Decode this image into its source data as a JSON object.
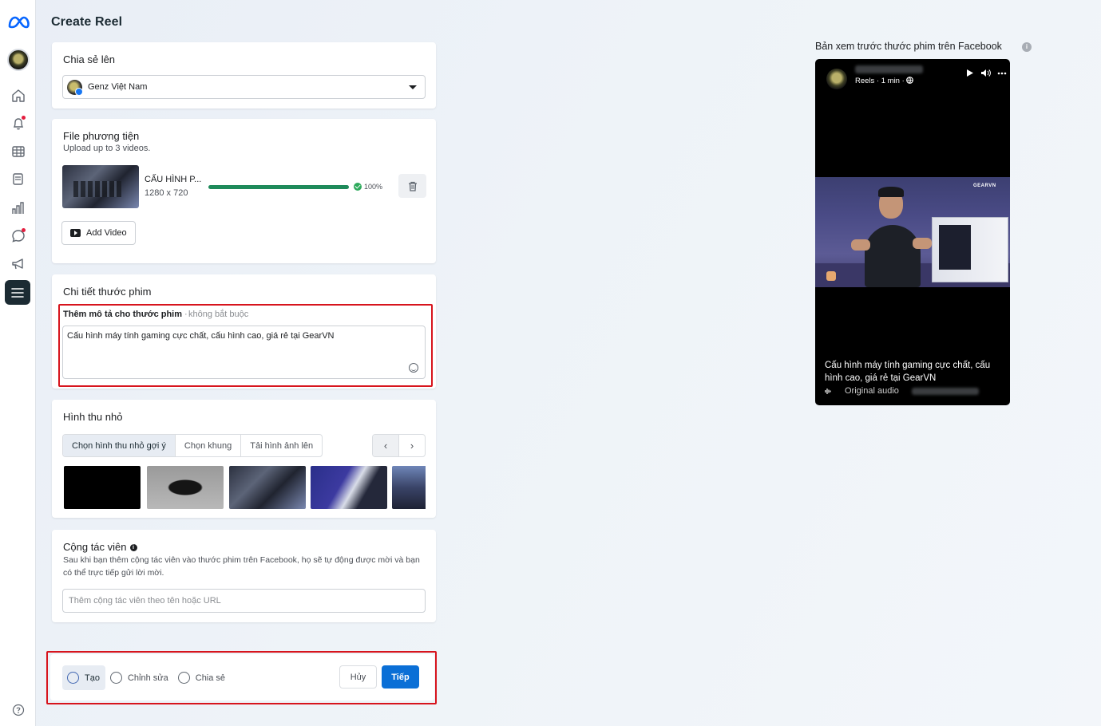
{
  "app": {
    "title": "Create Reel"
  },
  "rail": {
    "icons": [
      "meta-logo-icon",
      "home-icon",
      "bell-icon",
      "grid-icon",
      "pages-icon",
      "chart-icon",
      "chat-icon",
      "megaphone-icon",
      "menu-icon",
      "help-icon"
    ]
  },
  "share": {
    "title": "Chia sẻ lên",
    "selected_page": "Genz Việt Nam"
  },
  "media": {
    "title": "File phương tiện",
    "subtitle": "Upload up to 3 videos.",
    "file": {
      "name": "CẤU HÌNH P...",
      "resolution": "1280 x 720",
      "progress": 100,
      "progress_label": "100%"
    },
    "add_video_label": "Add Video"
  },
  "details": {
    "title": "Chi tiết thước phim",
    "description_label": "Thêm mô tả cho thước phim",
    "optional_label": "không bắt buộc",
    "description_value": "Cấu hình máy tính gaming cực chất, cấu hình cao, giá rẻ tại GearVN"
  },
  "thumbnail": {
    "title": "Hình thu nhỏ",
    "tabs": [
      "Chọn hình thu nhỏ gợi ý",
      "Chọn khung",
      "Tải hình ảnh lên"
    ],
    "active_tab": 0,
    "prev_label": "‹",
    "next_label": "›"
  },
  "collaborators": {
    "title": "Cộng tác viên",
    "info_glyph": "i",
    "description": "Sau khi bạn thêm cộng tác viên vào thước phim trên Facebook, họ sẽ tự động được mời và bạn có thể trực tiếp gửi lời mời.",
    "placeholder": "Thêm cộng tác viên theo tên hoặc URL"
  },
  "footer": {
    "steps": [
      "Tạo",
      "Chỉnh sửa",
      "Chia sẻ"
    ],
    "active_step": 0,
    "cancel_label": "Hủy",
    "next_label": "Tiếp"
  },
  "preview": {
    "title": "Bản xem trước thước phim trên Facebook",
    "info_glyph": "i",
    "meta": "Reels · 1 min · ",
    "caption": "Cấu hình máy tính gaming cực chất, cấu hình cao, giá rẻ tại GearVN",
    "audio_label": "Original audio",
    "brand_watermark": "GEARVN"
  },
  "colors": {
    "accent": "#0a6fd6",
    "progress": "#1e8a5a",
    "highlight_border": "#d7141d",
    "rail_active": "#1c2b33"
  }
}
